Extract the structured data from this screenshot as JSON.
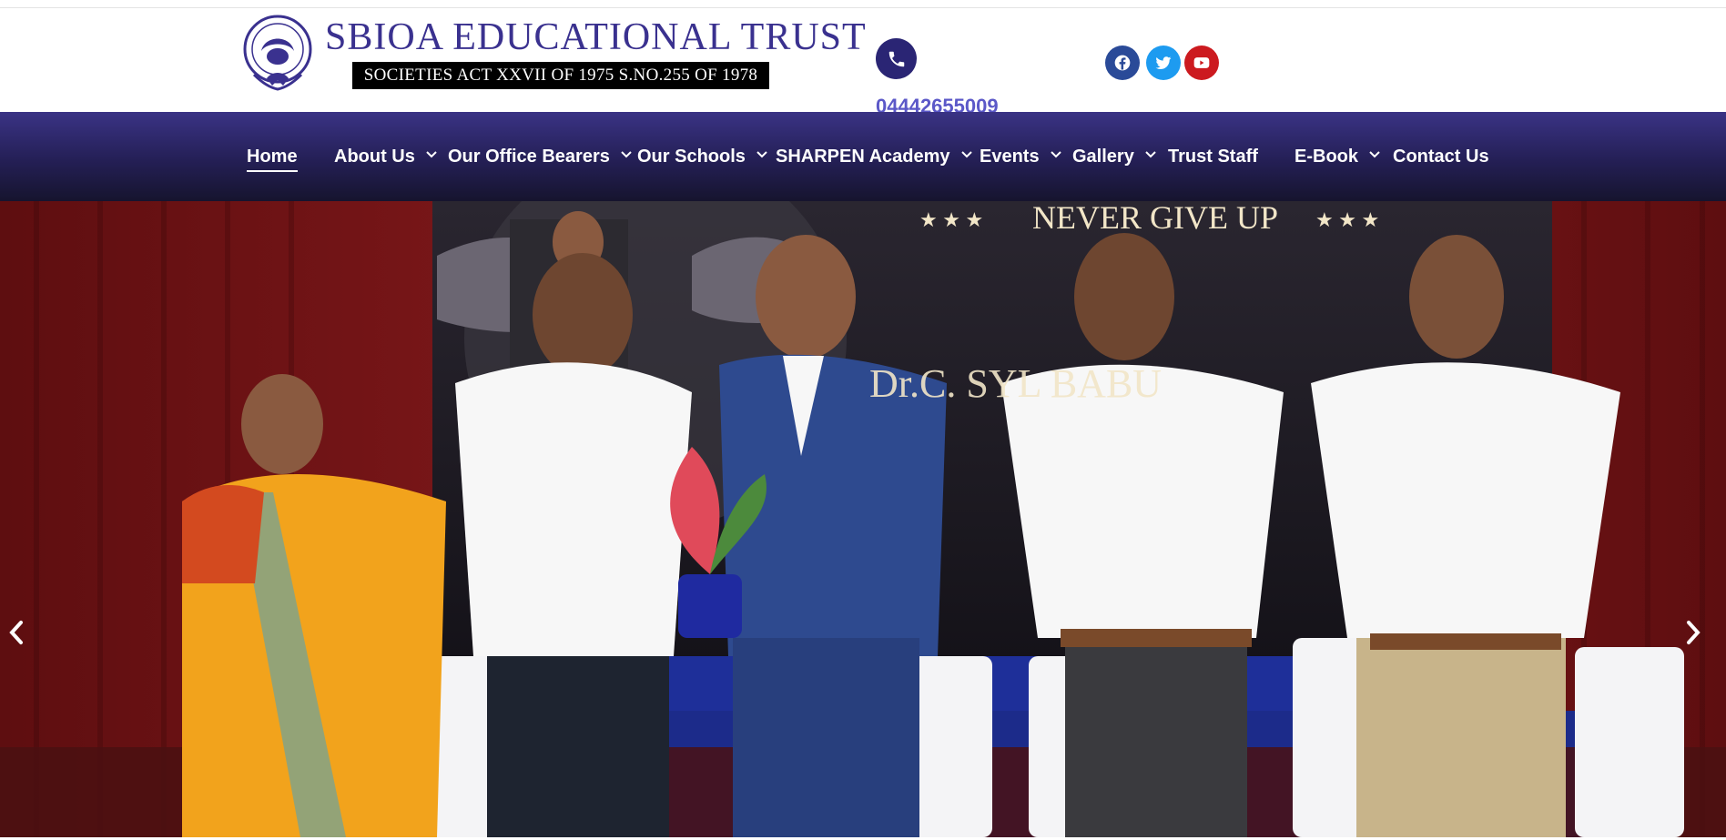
{
  "header": {
    "logo_icon": "trust-emblem-icon",
    "title": "SBIOA EDUCATIONAL TRUST",
    "subtitle": "SOCIETIES ACT XXVII OF 1975 S.NO.255 OF 1978",
    "phone_icon": "phone-icon",
    "phone_number": "04442655009",
    "social": [
      {
        "name": "facebook",
        "icon": "facebook-icon",
        "color": "#2a4a98"
      },
      {
        "name": "twitter",
        "icon": "twitter-icon",
        "color": "#1d9bf0"
      },
      {
        "name": "youtube",
        "icon": "youtube-icon",
        "color": "#cc1a1f"
      }
    ]
  },
  "nav": {
    "items": [
      {
        "label": "Home",
        "active": true,
        "dropdown": false
      },
      {
        "label": "About Us",
        "active": false,
        "dropdown": true
      },
      {
        "label": "Our Office Bearers",
        "active": false,
        "dropdown": true
      },
      {
        "label": "Our Schools",
        "active": false,
        "dropdown": true
      },
      {
        "label": "SHARPEN Academy",
        "active": false,
        "dropdown": true
      },
      {
        "label": "Events",
        "active": false,
        "dropdown": true
      },
      {
        "label": "Gallery",
        "active": false,
        "dropdown": true
      },
      {
        "label": "Trust Staff",
        "active": false,
        "dropdown": false
      },
      {
        "label": "E-Book",
        "active": false,
        "dropdown": true
      },
      {
        "label": "Contact Us",
        "active": false,
        "dropdown": false
      }
    ]
  },
  "hero": {
    "banner_text_top": "NEVER GIVE UP",
    "banner_text_name": "Dr.C. SYL      BABU",
    "controls": {
      "prev_icon": "chevron-left-icon",
      "next_icon": "chevron-right-icon"
    }
  },
  "colors": {
    "brand": "#3a318f",
    "nav_top": "#3a3385",
    "nav_bottom": "#16142e",
    "phone_text": "#5b58c8"
  }
}
